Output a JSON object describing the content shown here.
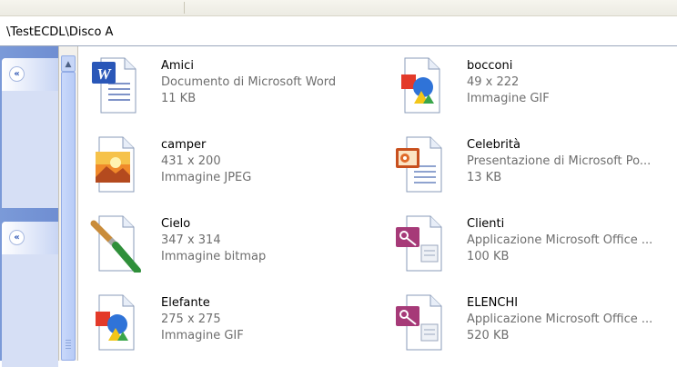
{
  "address": {
    "path": "\\TestECDL\\Disco A"
  },
  "taskpane": {
    "collapse_glyph": "«"
  },
  "files": [
    {
      "name": "Amici",
      "line2": "Documento di Microsoft Word",
      "line3": "11 KB",
      "icon": "word-document-icon"
    },
    {
      "name": "bocconi",
      "line2": "49 x 222",
      "line3": "Immagine GIF",
      "icon": "gif-image-icon"
    },
    {
      "name": "camper",
      "line2": "431 x 200",
      "line3": "Immagine JPEG",
      "icon": "jpeg-image-icon"
    },
    {
      "name": "Celebrità",
      "line2": "Presentazione di Microsoft Po...",
      "line3": "13 KB",
      "icon": "powerpoint-document-icon"
    },
    {
      "name": "Cielo",
      "line2": "347 x 314",
      "line3": "Immagine bitmap",
      "icon": "bitmap-paintbrush-icon"
    },
    {
      "name": "Clienti",
      "line2": "Applicazione Microsoft Office ...",
      "line3": "100 KB",
      "icon": "access-database-icon"
    },
    {
      "name": "Elefante",
      "line2": "275 x 275",
      "line3": "Immagine GIF",
      "icon": "gif-image-icon"
    },
    {
      "name": "ELENCHI",
      "line2": "Applicazione Microsoft Office ...",
      "line3": "520 KB",
      "icon": "access-database-icon"
    }
  ]
}
